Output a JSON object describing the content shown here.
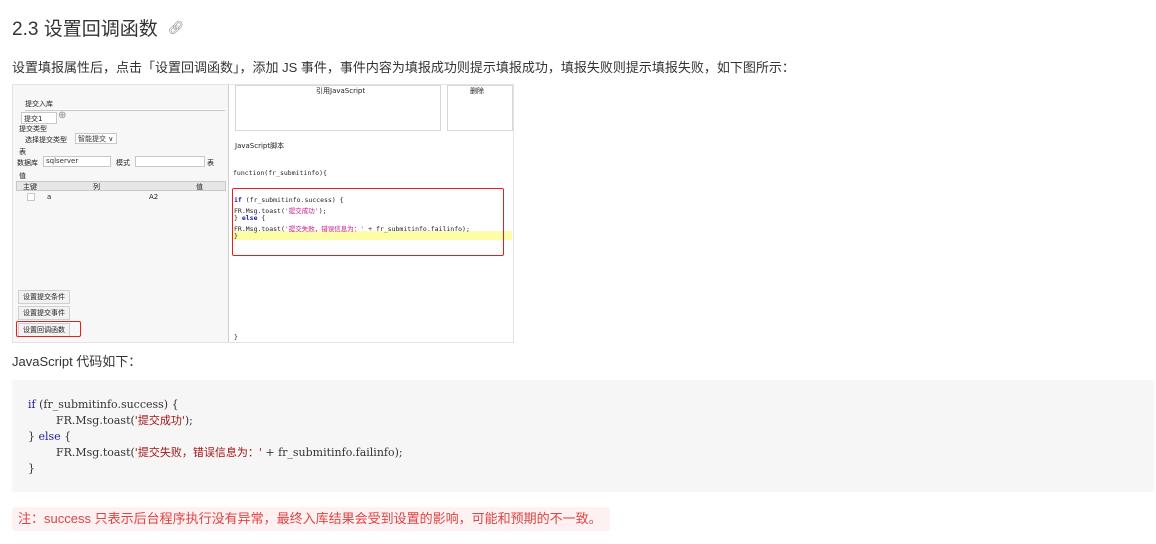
{
  "section": {
    "title": "2.3 设置回调函数",
    "anchor_icon": "link-icon"
  },
  "intro_text": "设置填报属性后，点击「设置回调函数」，添加 JS 事件，事件内容为填报成功则提示填报成功，填报失败则提示填报失败，如下图所示：",
  "figure": {
    "left_panel": {
      "submit_to_db": "提交入库",
      "submit1_tab": "提交1",
      "submit_type_header": "提交类型",
      "select_submit_type": "选择提交类型",
      "smart_submit": "智能提交",
      "table_header": "表",
      "database_label": "数据库",
      "database_value": "sqlserver",
      "mode_label": "模式",
      "table_label": "表",
      "value_header": "值",
      "col_primary_key": "主键",
      "col_column": "列",
      "col_value": "值",
      "row_column": "a",
      "row_value": "A2",
      "btn_set_submit_event_1": "设置提交条件",
      "btn_set_submit_event_2": "设置提交事件",
      "btn_set_callback": "设置回调函数"
    },
    "right_panel": {
      "ref_js": "引用JavaScript",
      "delete": "删除",
      "js_script": "JavaScript脚本",
      "function_sig": "function(fr_submitinfo){",
      "line1_kw": "if",
      "line1_rest": " (fr_submitinfo.success) {",
      "line2_pre": "    FR.Msg.toast(",
      "line2_str": "'提交成功'",
      "line2_post": ");",
      "line3_pre": "} ",
      "line3_kw": "else",
      "line3_post": " {",
      "line4_pre": "    FR.Msg.toast(",
      "line4_str": "'提交失败，错误信息为：'",
      "line4_post": " + fr_submitinfo.failinfo);",
      "line5": "}",
      "closing": "}"
    }
  },
  "js_label": "JavaScript 代码如下：",
  "code": {
    "l1_kw": "if",
    "l1_rest": " (fr_submitinfo.success) {",
    "l2_pre": "        FR.Msg.toast(",
    "l2_str": "'提交成功'",
    "l2_post": ");",
    "l3_pre": "} ",
    "l3_kw": "else",
    "l3_post": " {",
    "l4_pre": "        FR.Msg.toast(",
    "l4_str": "'提交失败，错误信息为：'",
    "l4_post": " + fr_submitinfo.failinfo);",
    "l5": "}"
  },
  "note": "注：success 只表示后台程序执行没有异常，最终入库结果会受到设置的影响，可能和预期的不一致。",
  "colors": {
    "note_text": "#e04343",
    "note_bg": "#fdf1f1",
    "highlight_box": "#e02020",
    "code_bg": "#f6f6f6"
  }
}
